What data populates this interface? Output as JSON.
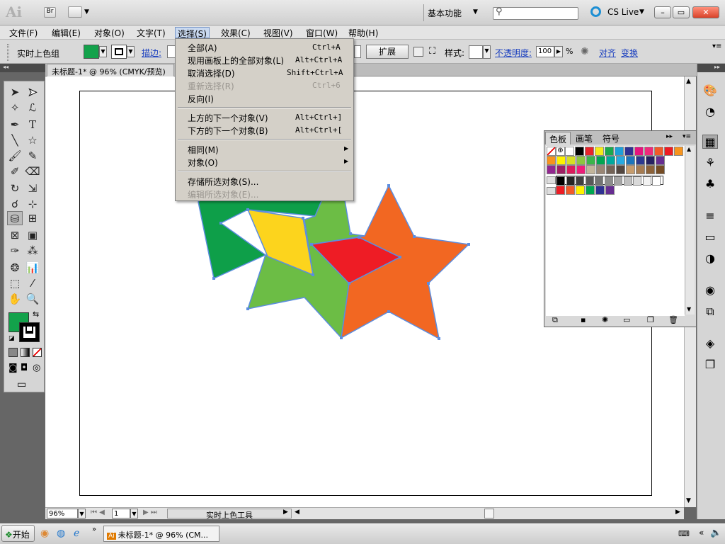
{
  "app": {
    "logo": "Ai",
    "bridge_label": "Br",
    "workspace": "基本功能",
    "cslive": "CS Live",
    "window_buttons": [
      "–",
      "▭",
      "✕"
    ]
  },
  "menubar": [
    {
      "label": "文件(F)",
      "id": "file"
    },
    {
      "label": "编辑(E)",
      "id": "edit"
    },
    {
      "label": "对象(O)",
      "id": "object"
    },
    {
      "label": "文字(T)",
      "id": "type"
    },
    {
      "label": "选择(S)",
      "id": "select"
    },
    {
      "label": "效果(C)",
      "id": "effect"
    },
    {
      "label": "视图(V)",
      "id": "view"
    },
    {
      "label": "窗口(W)",
      "id": "window"
    },
    {
      "label": "帮助(H)",
      "id": "help"
    }
  ],
  "control": {
    "group_label": "实时上色组",
    "stroke_label": "描边:",
    "expand_label": "扩展",
    "style_label": "样式:",
    "opacity_label": "不透明度:",
    "opacity_value": "100",
    "opacity_unit": "%",
    "align_label": "对齐",
    "transform_label": "变换",
    "fill_color": "#13a24b"
  },
  "document": {
    "tab_title": "未标题-1* @ 96% (CMYK/预览)"
  },
  "select_menu": {
    "items": [
      {
        "label": "全部(A)",
        "shortcut": "Ctrl+A",
        "disabled": false
      },
      {
        "label": "现用画板上的全部对象(L)",
        "shortcut": "Alt+Ctrl+A",
        "disabled": false
      },
      {
        "label": "取消选择(D)",
        "shortcut": "Shift+Ctrl+A",
        "disabled": false
      },
      {
        "label": "重新选择(R)",
        "shortcut": "Ctrl+6",
        "disabled": true
      },
      {
        "label": "反向(I)",
        "shortcut": "",
        "disabled": false
      },
      {
        "label": "上方的下一个对象(V)",
        "shortcut": "Alt+Ctrl+]",
        "disabled": false
      },
      {
        "label": "下方的下一个对象(B)",
        "shortcut": "Alt+Ctrl+[",
        "disabled": false
      },
      {
        "label": "相同(M)",
        "shortcut": "",
        "disabled": false,
        "submenu": true
      },
      {
        "label": "对象(O)",
        "shortcut": "",
        "disabled": false,
        "submenu": true
      },
      {
        "label": "存储所选对象(S)...",
        "shortcut": "",
        "disabled": false
      },
      {
        "label": "编辑所选对象(E)...",
        "shortcut": "",
        "disabled": true
      }
    ],
    "submenu_arrow": "▶"
  },
  "swatches": {
    "tabs": [
      "色板",
      "画笔",
      "符号"
    ],
    "row1": [
      "#ffffff",
      "#000000",
      "#e8242b",
      "#f4ea1a",
      "#1aa84c",
      "#1d9fd8",
      "#2e3192",
      "#e4147e",
      "#ee2a7b",
      "#f15a29",
      "#ed1c24",
      "#f7941d"
    ],
    "row2": [
      "#f7941d",
      "#fff200",
      "#d7df23",
      "#8dc63f",
      "#39b54a",
      "#00a651",
      "#00a99d",
      "#27aae1",
      "#1c75bc",
      "#2b3990",
      "#262262",
      "#662d91"
    ],
    "row3": [
      "#92278f",
      "#9e1f63",
      "#da1c5c",
      "#ed1e79",
      "#c2b59b",
      "#998675",
      "#736357",
      "#534741",
      "#c69c6d",
      "#a67c52",
      "#8c6239",
      "#754c24"
    ],
    "gray": [
      "#000000",
      "#262626",
      "#404040",
      "#595959",
      "#737373",
      "#8c8c8c",
      "#a6a6a6",
      "#bfbfbf",
      "#d9d9d9",
      "#f2f2f2",
      "#ffffff"
    ],
    "group": [
      "#ed1c24",
      "#f15a29",
      "#fff200",
      "#00a651",
      "#2e3192",
      "#662d91"
    ]
  },
  "status": {
    "zoom": "96%",
    "page": "1",
    "tool": "实时上色工具"
  },
  "taskbar": {
    "start": "开始",
    "item": "未标题-1* @ 96% (CM..."
  },
  "art": {
    "green": "#0e9f49",
    "lightgreen": "#6cbd45",
    "yellow": "#fcd41d",
    "red": "#ee1c25",
    "orange": "#f26722",
    "stroke": "#5b8de0"
  }
}
